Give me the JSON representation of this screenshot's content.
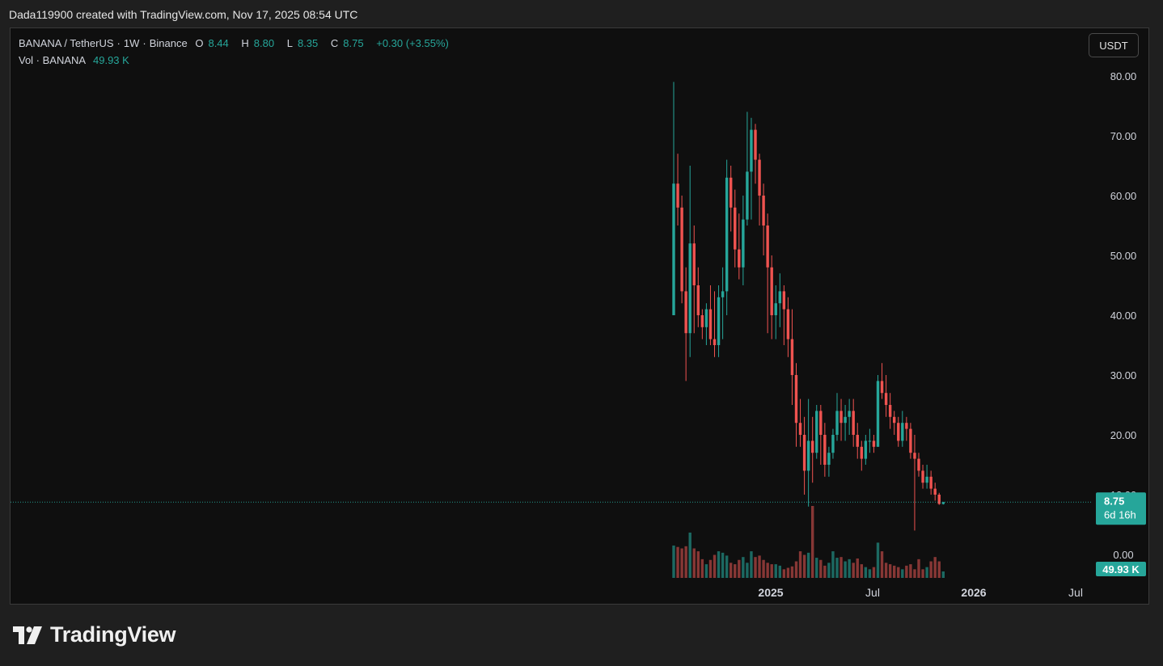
{
  "header": {
    "caption": "Dada119900 created with TradingView.com, Nov 17, 2025 08:54 UTC"
  },
  "legend": {
    "symbol": "BANANA / TetherUS",
    "interval": "1W",
    "exchange": "Binance",
    "open_label": "O",
    "open": "8.44",
    "high_label": "H",
    "high": "8.80",
    "low_label": "L",
    "low": "8.35",
    "close_label": "C",
    "close": "8.75",
    "change": "+0.30 (+3.55%)",
    "vol_label": "Vol · BANANA",
    "vol_value": "49.93 K"
  },
  "currency_button": "USDT",
  "price_tag": {
    "price": "8.75",
    "countdown": "6d 16h"
  },
  "volume_tag": "49.93 K",
  "brand": {
    "name": "TradingView"
  },
  "colors": {
    "up": "#26a69a",
    "down": "#ef5350",
    "background": "#0f0f0f",
    "text": "#d1d4dc"
  },
  "chart_data": {
    "type": "candlestick",
    "title": "BANANA / TetherUS · 1W · Binance",
    "y_axis": {
      "ticks": [
        "80.00",
        "70.00",
        "60.00",
        "50.00",
        "40.00",
        "30.00",
        "20.00",
        "10.00",
        "0.00"
      ],
      "ylim": [
        0,
        80
      ],
      "side": "right"
    },
    "x_axis": {
      "ticks": [
        "2025",
        "Jul",
        "2026",
        "Jul"
      ]
    },
    "grid": false,
    "last_price": 8.75,
    "series": [
      {
        "name": "BANANA / TetherUS",
        "ohlc": [
          [
            40,
            79,
            40,
            62
          ],
          [
            62,
            67,
            55,
            58
          ],
          [
            58,
            60,
            42,
            44
          ],
          [
            44,
            48,
            29,
            37
          ],
          [
            37,
            65,
            33,
            52
          ],
          [
            52,
            55,
            37,
            45
          ],
          [
            45,
            48,
            38,
            40
          ],
          [
            40,
            41,
            36,
            38
          ],
          [
            38,
            42,
            35,
            41
          ],
          [
            41,
            45,
            35,
            36
          ],
          [
            36,
            44,
            33,
            35
          ],
          [
            35,
            45,
            33,
            43
          ],
          [
            43,
            48,
            36,
            44
          ],
          [
            44,
            66,
            40,
            63
          ],
          [
            63,
            65,
            54,
            58
          ],
          [
            58,
            61,
            48,
            51
          ],
          [
            51,
            57,
            46,
            48
          ],
          [
            48,
            60,
            45,
            56
          ],
          [
            56,
            74,
            55,
            64
          ],
          [
            64,
            73,
            56,
            71
          ],
          [
            71,
            72,
            62,
            66
          ],
          [
            66,
            67,
            55,
            60
          ],
          [
            60,
            62,
            50,
            55
          ],
          [
            55,
            57,
            37,
            48
          ],
          [
            48,
            50,
            36,
            40
          ],
          [
            40,
            45,
            36,
            42
          ],
          [
            42,
            47,
            38,
            44
          ],
          [
            44,
            45,
            35,
            41
          ],
          [
            41,
            43,
            33,
            36
          ],
          [
            36,
            41,
            25,
            30
          ],
          [
            30,
            32,
            18,
            22
          ],
          [
            22,
            26,
            18,
            20
          ],
          [
            20,
            23,
            10,
            14
          ],
          [
            14,
            26,
            8,
            19
          ],
          [
            19,
            23,
            12,
            17
          ],
          [
            17,
            25,
            16,
            24
          ],
          [
            24,
            25,
            15,
            20
          ],
          [
            20,
            22,
            13,
            15
          ],
          [
            15,
            18,
            13,
            17
          ],
          [
            17,
            21,
            16,
            20
          ],
          [
            20,
            27,
            19,
            24
          ],
          [
            24,
            26,
            19,
            22
          ],
          [
            22,
            25,
            19,
            23
          ],
          [
            23,
            26,
            20,
            24
          ],
          [
            24,
            26,
            18,
            20
          ],
          [
            20,
            22,
            16,
            18
          ],
          [
            18,
            19,
            14,
            16
          ],
          [
            16,
            20,
            15,
            19
          ],
          [
            19,
            21,
            17,
            19
          ],
          [
            19,
            20,
            17,
            18
          ],
          [
            18,
            30,
            18,
            29
          ],
          [
            29,
            32,
            26,
            27
          ],
          [
            27,
            30,
            23,
            25
          ],
          [
            25,
            27,
            21,
            23
          ],
          [
            23,
            24,
            20,
            22
          ],
          [
            22,
            23,
            18,
            19
          ],
          [
            19,
            24,
            18,
            22
          ],
          [
            22,
            23,
            19,
            21
          ],
          [
            21,
            22,
            16,
            17
          ],
          [
            17,
            20,
            4,
            16
          ],
          [
            16,
            17,
            13,
            14
          ],
          [
            14,
            15,
            11,
            12
          ],
          [
            12,
            15,
            11,
            13
          ],
          [
            13,
            14,
            10,
            11
          ],
          [
            11,
            12,
            9,
            10
          ],
          [
            10,
            10.3,
            8.3,
            8.45
          ],
          [
            8.44,
            8.8,
            8.35,
            8.75
          ]
        ]
      },
      {
        "name": "Vol · BANANA",
        "volume": [
          45,
          43,
          41,
          44,
          63,
          41,
          37,
          26,
          19,
          25,
          32,
          37,
          35,
          31,
          21,
          19,
          25,
          29,
          21,
          37,
          29,
          31,
          25,
          21,
          19,
          19,
          17,
          12,
          14,
          16,
          23,
          37,
          32,
          35,
          100,
          28,
          25,
          17,
          21,
          37,
          28,
          29,
          23,
          26,
          21,
          27,
          19,
          15,
          12,
          15,
          49,
          37,
          21,
          19,
          17,
          15,
          12,
          17,
          19,
          12,
          26,
          12,
          15,
          23,
          29,
          23,
          9
        ]
      }
    ]
  }
}
